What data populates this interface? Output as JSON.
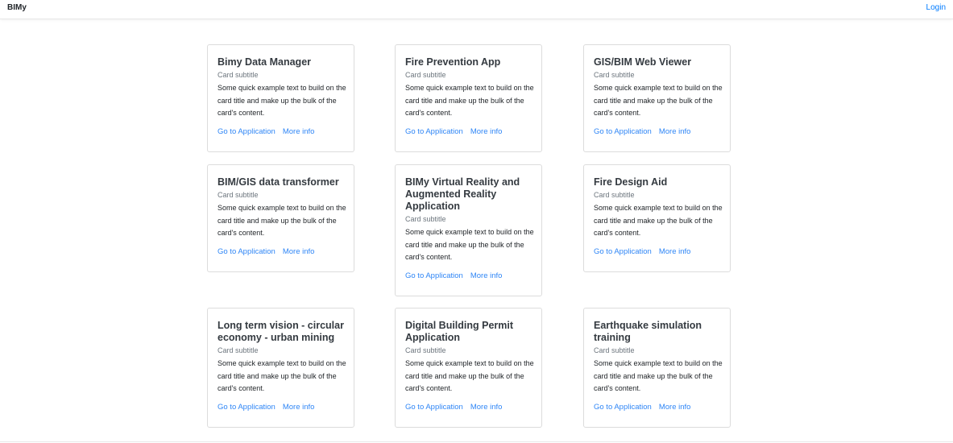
{
  "navbar": {
    "brand": "BIMy",
    "login": "Login"
  },
  "cards": [
    {
      "title": "Bimy Data Manager",
      "subtitle": "Card subtitle",
      "text": "Some quick example text to build on the card title and make up the bulk of the card's content.",
      "link_app": "Go to Application",
      "link_info": "More info"
    },
    {
      "title": "Fire Prevention App",
      "subtitle": "Card subtitle",
      "text": "Some quick example text to build on the card title and make up the bulk of the card's content.",
      "link_app": "Go to Application",
      "link_info": "More info"
    },
    {
      "title": "GIS/BIM Web Viewer",
      "subtitle": "Card subtitle",
      "text": "Some quick example text to build on the card title and make up the bulk of the card's content.",
      "link_app": "Go to Application",
      "link_info": "More info"
    },
    {
      "title": "BIM/GIS data transformer",
      "subtitle": "Card subtitle",
      "text": "Some quick example text to build on the card title and make up the bulk of the card's content.",
      "link_app": "Go to Application",
      "link_info": "More info"
    },
    {
      "title": "BIMy Virtual Reality and Augmented Reality Application",
      "subtitle": "Card subtitle",
      "text": "Some quick example text to build on the card title and make up the bulk of the card's content.",
      "link_app": "Go to Application",
      "link_info": "More info"
    },
    {
      "title": "Fire Design Aid",
      "subtitle": "Card subtitle",
      "text": "Some quick example text to build on the card title and make up the bulk of the card's content.",
      "link_app": "Go to Application",
      "link_info": "More info"
    },
    {
      "title": "Long term vision - circular economy - urban mining",
      "subtitle": "Card subtitle",
      "text": "Some quick example text to build on the card title and make up the bulk of the card's content.",
      "link_app": "Go to Application",
      "link_info": "More info"
    },
    {
      "title": "Digital Building Permit Application",
      "subtitle": "Card subtitle",
      "text": "Some quick example text to build on the card title and make up the bulk of the card's content.",
      "link_app": "Go to Application",
      "link_info": "More info"
    },
    {
      "title": "Earthquake simulation training",
      "subtitle": "Card subtitle",
      "text": "Some quick example text to build on the card title and make up the bulk of the card's content.",
      "link_app": "Go to Application",
      "link_info": "More info"
    }
  ]
}
